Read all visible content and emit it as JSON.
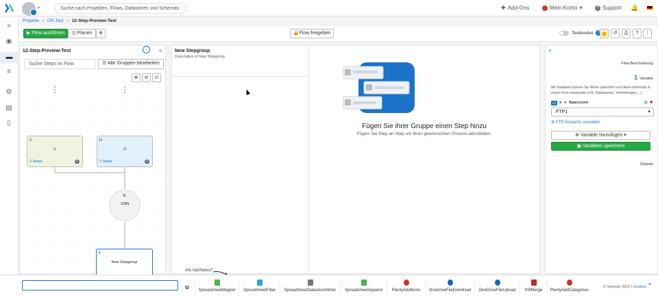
{
  "topnav": {
    "search_placeholder": "Suche nach Projekten, Flows, Datastores und Schemas",
    "addons": "Add-Ons",
    "account": "Mein Konto",
    "support": "Support"
  },
  "breadcrumb": [
    "Projekte",
    "CR-Test",
    "12-Step-Preview-Test"
  ],
  "toolbar": {
    "run": "Flow ausführen",
    "plan": "Planen",
    "share": "Flow freigeben",
    "testmode": "Testmodus"
  },
  "left_panel": {
    "title": "12-Step-Preview-Test",
    "search_placeholder": "Suche Steps im Flow",
    "edit_groups": "Alle Gruppen bearbeiten",
    "nodes": {
      "c": {
        "letter": "C",
        "name": "-1-",
        "steps": "2 Steps",
        "count": "6"
      },
      "d": {
        "letter": "D",
        "name": "-2-",
        "steps": "2 Steps",
        "count": "6"
      },
      "e": {
        "letter": "E",
        "name": "JOIN"
      },
      "f": {
        "letter": "F",
        "name": "New Stepgroup"
      }
    }
  },
  "middle_panel": {
    "group_title": "New Stepgroup",
    "group_desc": "Description of New Stepgroup",
    "empty_title": "Fügen Sie ihrer Gruppe einen Step hinzu",
    "empty_sub": "Fügen Sie Step an Step um ihren gewünschten Prozess abzubilden."
  },
  "right_panel": {
    "flow_desc": "Flow Beschreibung",
    "var_count": "1",
    "var_label": "Variable",
    "var_help": "Mit Variablen können Sie Werte speichern und diese mehrmals in einem Flow verwenden (z.B. Dateinamen, Verbindungen ...)",
    "var_tag": "V1",
    "var_name": "ftpaccount",
    "var_value": "FTP1",
    "ftp_link": "FTP Accounts verwalten",
    "add_var": "Variable hinzufügen",
    "save_var": "Variablen speichern",
    "outputs": "Outputs"
  },
  "bottom_bar": {
    "hint": "Als nächstes?",
    "components": [
      {
        "label": "SpreadsheetMapper",
        "color": "#4caf50"
      },
      {
        "label": "SpreadsheetFilter",
        "color": "#29a3d9"
      },
      {
        "label": "SpreadsheetDatastoreWriter",
        "color": "#777777"
      },
      {
        "label": "SpreadsheetAppend",
        "color": "#4caf50"
      },
      {
        "label": "PlentyAddItems",
        "color": "#d32f2f"
      },
      {
        "label": "OneDriveFileDownload",
        "color": "#1565c0"
      },
      {
        "label": "OneDriveFileUpload",
        "color": "#1565c0"
      },
      {
        "label": "PdfMerge",
        "color": "#c62828"
      },
      {
        "label": "PlentyAddCategories",
        "color": "#d32f2f"
      }
    ],
    "footer_brand": "© Synesty",
    "footer_year": "2022",
    "footer_cookies": "Cookies"
  }
}
